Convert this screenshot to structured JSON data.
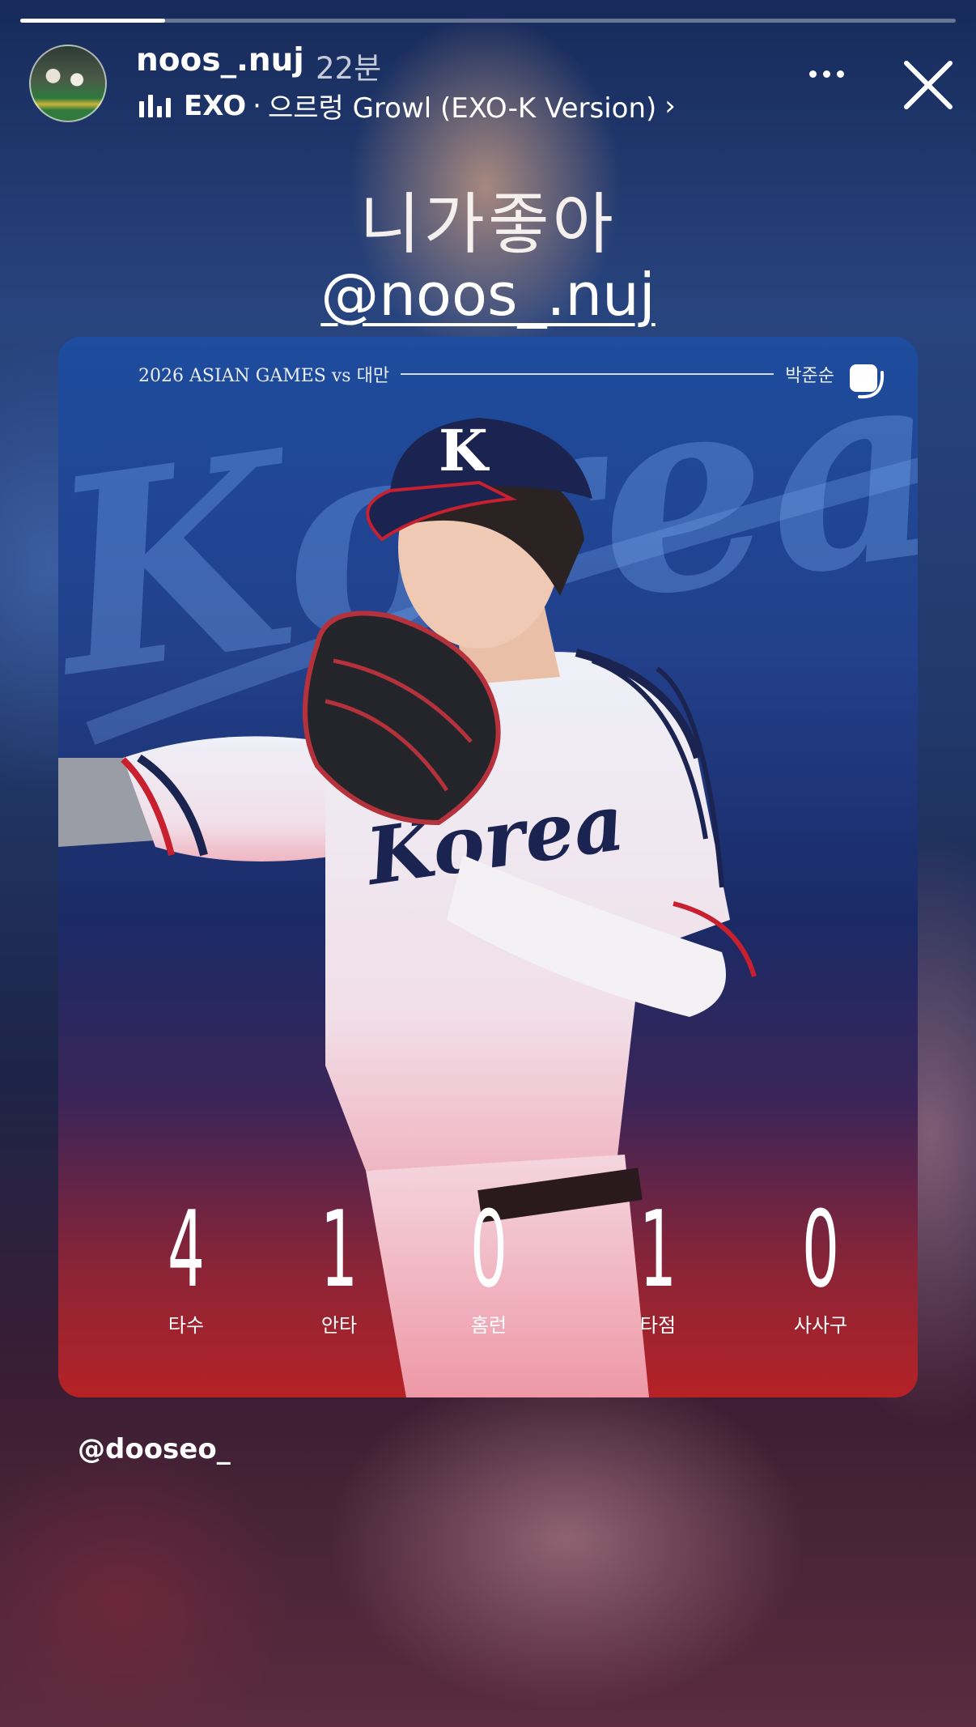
{
  "story": {
    "progress_fraction": 0.155,
    "username": "noos_.nuj",
    "time": "22분",
    "music": {
      "artist": "EXO",
      "separator": "·",
      "title": "으르렁 Growl (EXO-K Version)",
      "chevron": "›"
    },
    "icons": {
      "music": "music-bars-icon",
      "more": "more-dots-icon",
      "close": "close-icon"
    }
  },
  "overlay": {
    "caption": "니가좋아",
    "mention": "@noos_.nuj",
    "bottom_tag": "@dooseo_"
  },
  "card": {
    "header_left": "2026 ASIAN GAMES vs 대만",
    "header_right": "박준순",
    "watermark": "Korea",
    "jersey_text": "Korea",
    "cap_letter": "K",
    "stats": [
      {
        "value": "4",
        "label": "타수"
      },
      {
        "value": "1",
        "label": "안타"
      },
      {
        "value": "0",
        "label": "홈런"
      },
      {
        "value": "1",
        "label": "타점"
      },
      {
        "value": "0",
        "label": "사사구"
      }
    ]
  }
}
